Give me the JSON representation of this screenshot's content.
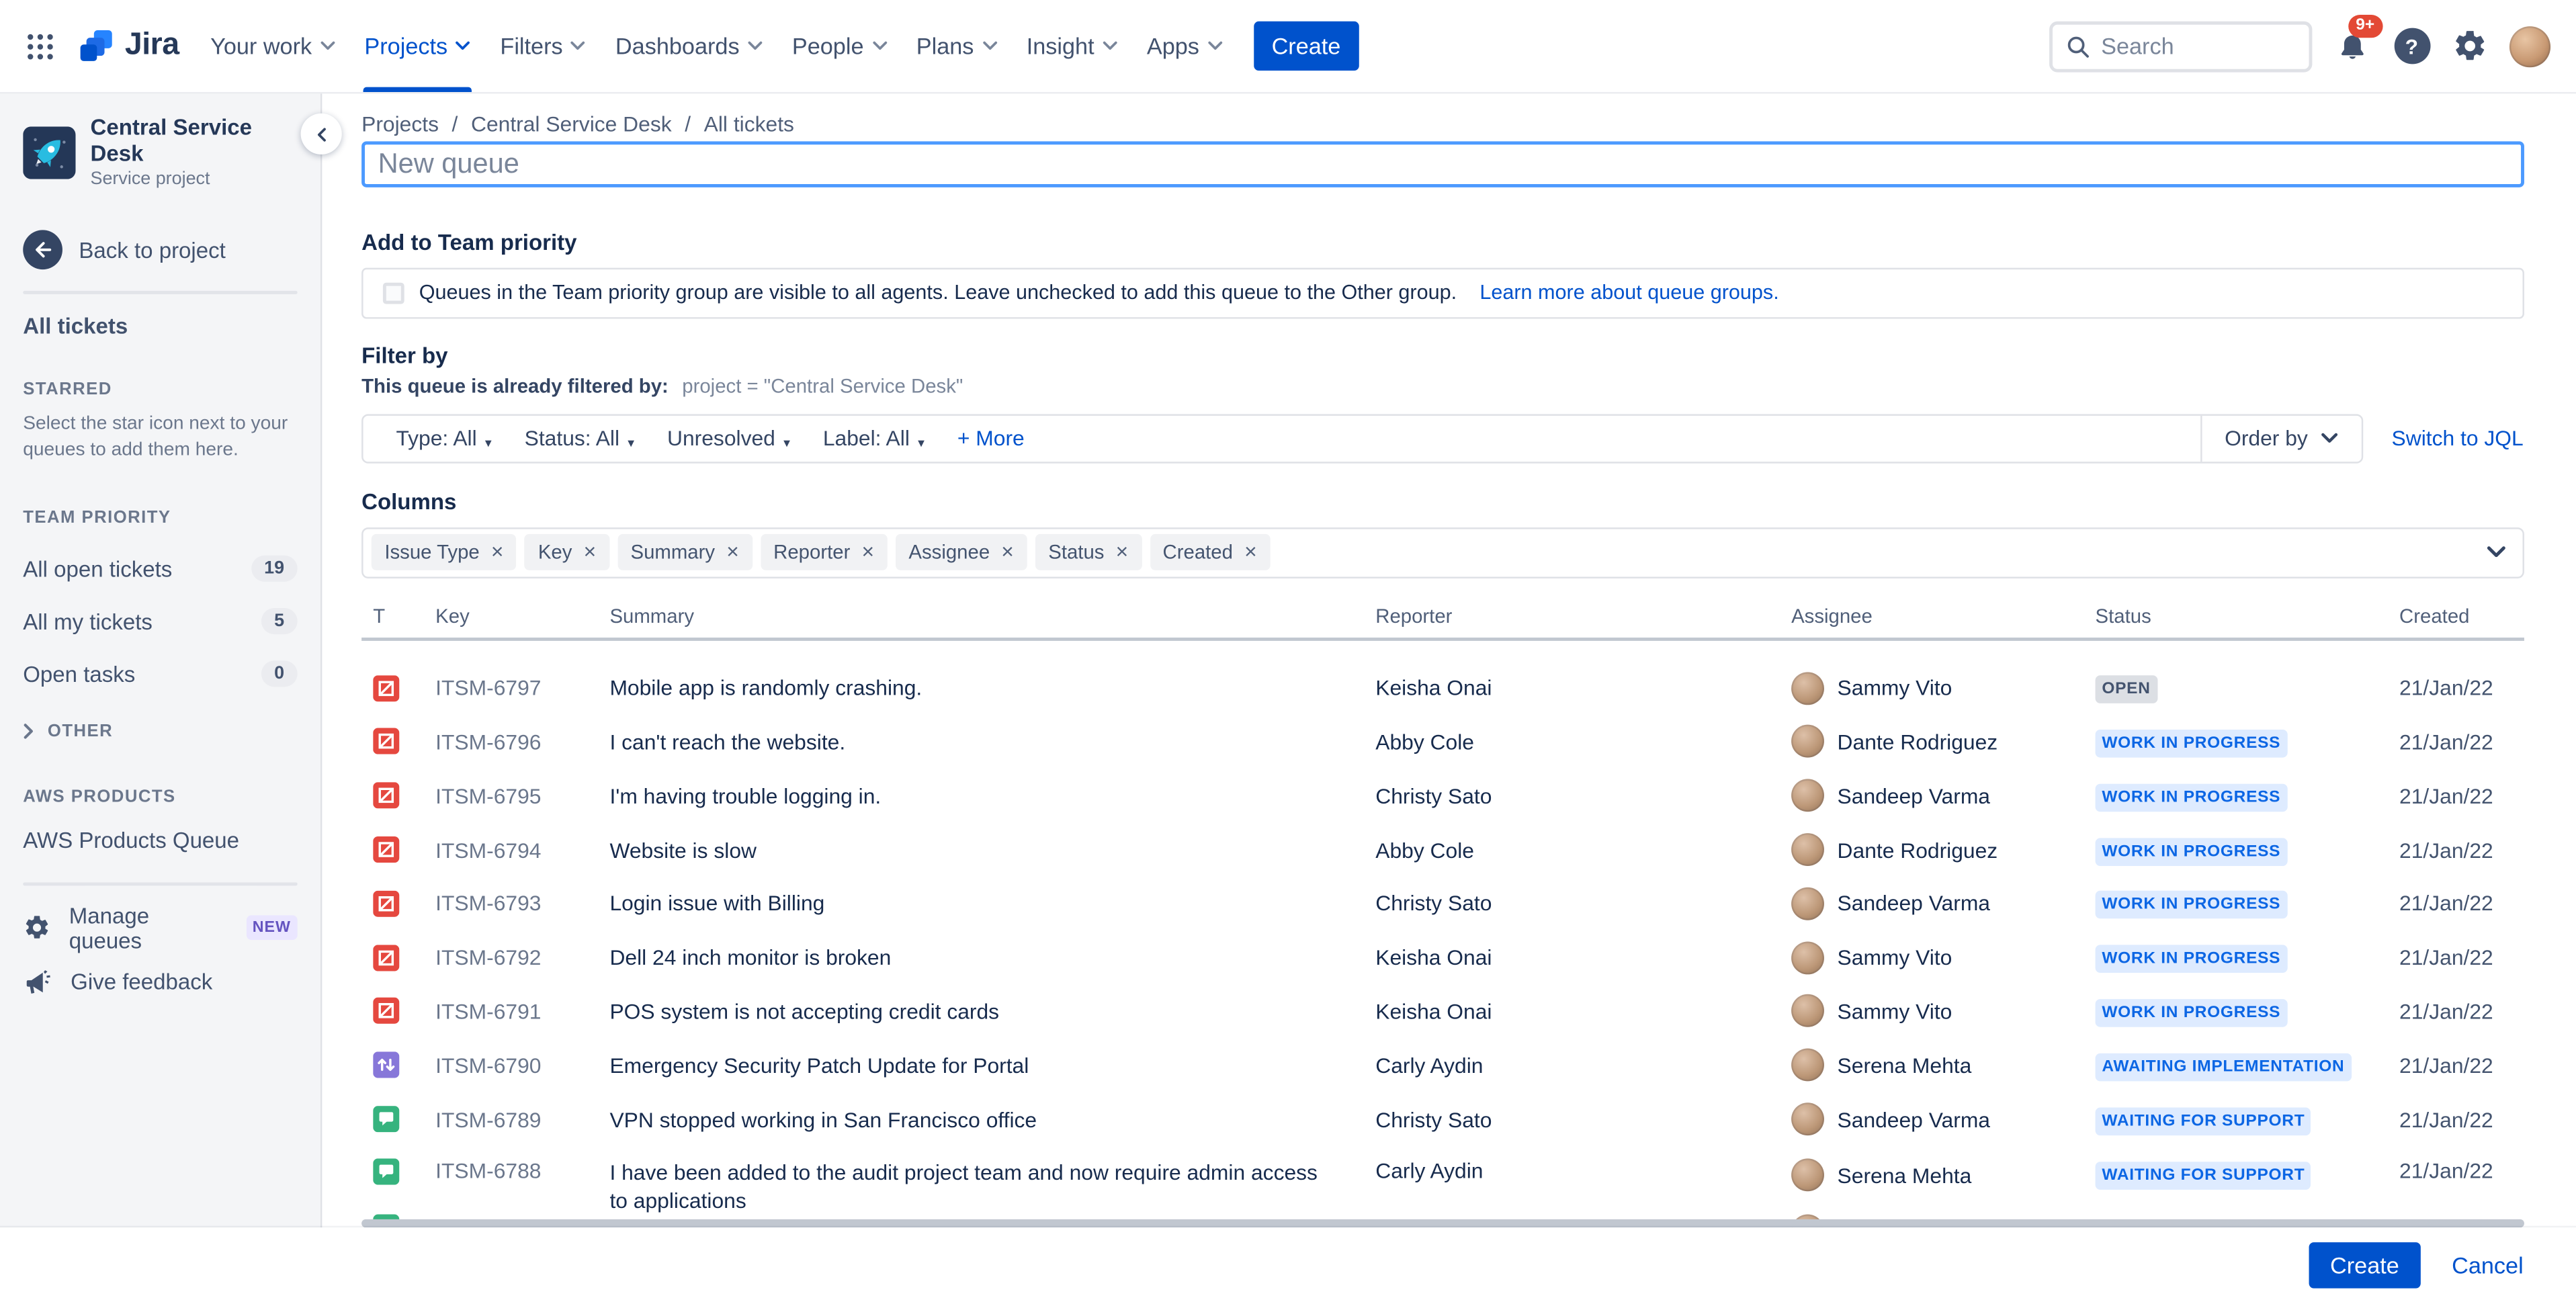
{
  "colors": {
    "brand_blue": "#0052CC",
    "focus_blue": "#4C9AFF",
    "notification_red": "#E34935",
    "incident_red": "#E5483F",
    "change_purple": "#8777D9",
    "support_green": "#36B37E",
    "lozenge_blue_bg": "#DEEBFF",
    "lozenge_blue_text": "#0C66E4",
    "lozenge_gray_bg": "#DCDFE4",
    "lozenge_gray_text": "#44546F",
    "sidebar_bg": "#F4F5F7",
    "new_badge_bg": "#EAE6FF",
    "new_badge_text": "#6554C0"
  },
  "nav": {
    "logo_text": "Jira",
    "menu": [
      {
        "label": "Your work",
        "active": false
      },
      {
        "label": "Projects",
        "active": true
      },
      {
        "label": "Filters",
        "active": false
      },
      {
        "label": "Dashboards",
        "active": false
      },
      {
        "label": "People",
        "active": false
      },
      {
        "label": "Plans",
        "active": false
      },
      {
        "label": "Insight",
        "active": false
      },
      {
        "label": "Apps",
        "active": false
      }
    ],
    "create_label": "Create",
    "search_placeholder": "Search",
    "notification_count": "9+",
    "help_glyph": "?"
  },
  "sidebar": {
    "project_name": "Central Service Desk",
    "project_type": "Service project",
    "back_label": "Back to project",
    "all_tickets_label": "All tickets",
    "starred_header": "STARRED",
    "starred_hint": "Select the star icon next to your queues to add them here.",
    "team_priority_header": "TEAM PRIORITY",
    "team_priority_items": [
      {
        "label": "All open tickets",
        "count": "19"
      },
      {
        "label": "All my tickets",
        "count": "5"
      },
      {
        "label": "Open tasks",
        "count": "0"
      }
    ],
    "other_header": "OTHER",
    "aws_header": "AWS PRODUCTS",
    "aws_items": [
      {
        "label": "AWS Products Queue"
      }
    ],
    "manage_queues_label": "Manage queues",
    "manage_queues_badge": "NEW",
    "give_feedback_label": "Give feedback"
  },
  "main": {
    "breadcrumb": [
      "Projects",
      "Central Service Desk",
      "All tickets"
    ],
    "breadcrumb_separator": "/",
    "queue_name_placeholder": "New queue",
    "team_priority_section": {
      "heading": "Add to Team priority",
      "checkbox_label": "Queues in the Team priority group are visible to all agents. Leave unchecked to add this queue to the Other group.",
      "link_label": "Learn more about queue groups."
    },
    "filter_section": {
      "heading": "Filter by",
      "filtered_by_prefix": "This queue is already filtered by:",
      "filtered_by_jql": "project = \"Central Service Desk\"",
      "dropdowns": [
        "Type: All",
        "Status: All",
        "Unresolved",
        "Label: All"
      ],
      "more_label": "+ More",
      "order_by_label": "Order by",
      "switch_to_jql_label": "Switch to JQL"
    },
    "columns_section": {
      "heading": "Columns",
      "chips": [
        "Issue Type",
        "Key",
        "Summary",
        "Reporter",
        "Assignee",
        "Status",
        "Created"
      ]
    },
    "table": {
      "headers": [
        "T",
        "Key",
        "Summary",
        "Reporter",
        "Assignee",
        "Status",
        "Created"
      ],
      "rows": [
        {
          "type": "incident",
          "key": "ITSM-6797",
          "summary": "Mobile app is randomly crashing.",
          "reporter": "Keisha Onai",
          "assignee": "Sammy Vito",
          "status": "OPEN",
          "status_style": "gray",
          "created": "21/Jan/22"
        },
        {
          "type": "incident",
          "key": "ITSM-6796",
          "summary": "I can't reach the website.",
          "reporter": "Abby Cole",
          "assignee": "Dante Rodriguez",
          "status": "WORK IN PROGRESS",
          "status_style": "blue",
          "created": "21/Jan/22"
        },
        {
          "type": "incident",
          "key": "ITSM-6795",
          "summary": "I'm having trouble logging in.",
          "reporter": "Christy Sato",
          "assignee": "Sandeep Varma",
          "status": "WORK IN PROGRESS",
          "status_style": "blue",
          "created": "21/Jan/22"
        },
        {
          "type": "incident",
          "key": "ITSM-6794",
          "summary": "Website is slow",
          "reporter": "Abby Cole",
          "assignee": "Dante Rodriguez",
          "status": "WORK IN PROGRESS",
          "status_style": "blue",
          "created": "21/Jan/22"
        },
        {
          "type": "incident",
          "key": "ITSM-6793",
          "summary": "Login issue with Billing",
          "reporter": "Christy Sato",
          "assignee": "Sandeep Varma",
          "status": "WORK IN PROGRESS",
          "status_style": "blue",
          "created": "21/Jan/22"
        },
        {
          "type": "incident",
          "key": "ITSM-6792",
          "summary": "Dell 24 inch monitor is broken",
          "reporter": "Keisha Onai",
          "assignee": "Sammy Vito",
          "status": "WORK IN PROGRESS",
          "status_style": "blue",
          "created": "21/Jan/22"
        },
        {
          "type": "incident",
          "key": "ITSM-6791",
          "summary": "POS system is not accepting credit cards",
          "reporter": "Keisha Onai",
          "assignee": "Sammy Vito",
          "status": "WORK IN PROGRESS",
          "status_style": "blue",
          "created": "21/Jan/22"
        },
        {
          "type": "change",
          "key": "ITSM-6790",
          "summary": "Emergency Security Patch Update for Portal",
          "reporter": "Carly Aydin",
          "assignee": "Serena Mehta",
          "status": "AWAITING IMPLEMENTATION",
          "status_style": "blue",
          "created": "21/Jan/22"
        },
        {
          "type": "support",
          "key": "ITSM-6789",
          "summary": "VPN stopped working in San Francisco office",
          "reporter": "Christy Sato",
          "assignee": "Sandeep Varma",
          "status": "WAITING FOR SUPPORT",
          "status_style": "blue",
          "created": "21/Jan/22"
        },
        {
          "type": "support",
          "key": "ITSM-6788",
          "summary": "I have been added to the audit project team and now require admin access to applications",
          "reporter": "Carly Aydin",
          "assignee": "Serena Mehta",
          "status": "WAITING FOR SUPPORT",
          "status_style": "blue",
          "created": "21/Jan/22"
        },
        {
          "type": "support",
          "partial": true
        }
      ]
    },
    "footer": {
      "create_label": "Create",
      "cancel_label": "Cancel"
    }
  }
}
